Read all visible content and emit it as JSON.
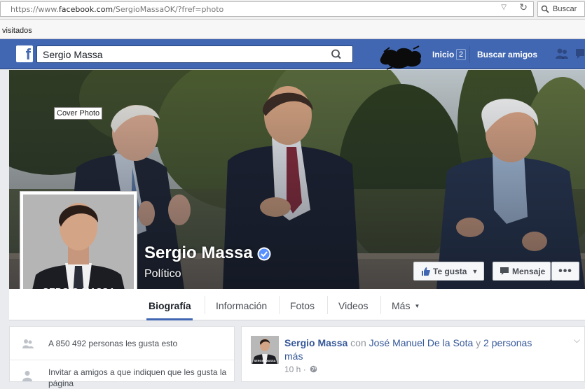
{
  "browser": {
    "url_proto": "https://www.",
    "url_domain": "facebook.com",
    "url_path": "/SergioMassaOK/?fref=photo",
    "search_label": "Buscar",
    "bookmark": "visitados"
  },
  "fb": {
    "search_value": "Sergio Massa",
    "nav_home": "Inicio",
    "nav_home_count": "2",
    "nav_find_friends": "Buscar amigos",
    "brand_color": "#4267b2"
  },
  "page": {
    "cover_tooltip": "Cover Photo",
    "avatar_caption": "SERGIO MASSA",
    "name": "Sergio Massa",
    "category": "Político",
    "like_button": "Te gusta",
    "message_button": "Mensaje",
    "more_button": "•••"
  },
  "tabs": [
    {
      "label": "Biografía",
      "active": true
    },
    {
      "label": "Información"
    },
    {
      "label": "Fotos"
    },
    {
      "label": "Videos"
    },
    {
      "label": "Más"
    }
  ],
  "sidebar": {
    "likes_text": "A 850 492 personas les gusta esto",
    "invite_text": "Invitar a amigos a que indiquen que les gusta la página"
  },
  "post": {
    "author": "Sergio Massa",
    "with_word": "con",
    "tagged": "José Manuel De la Sota",
    "and_word": "y",
    "others": "2 personas más",
    "time": "10 h ·",
    "thumb_caption": "SERGIO MASSA"
  }
}
